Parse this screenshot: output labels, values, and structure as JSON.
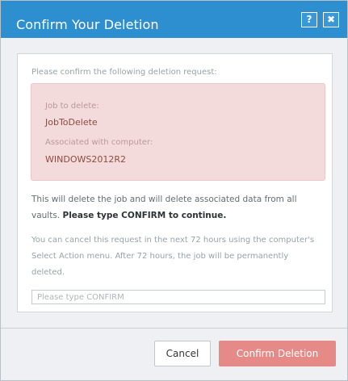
{
  "dialog": {
    "title": "Confirm Your Deletion",
    "help_label": "?",
    "close_label": "✖"
  },
  "content": {
    "intro": "Please confirm the following deletion request:",
    "job_label": "Job to delete:",
    "job_value": "JobToDelete",
    "computer_label": "Associated with computer:",
    "computer_value": "WINDOWS2012R2",
    "warning_text": "This will delete the job and will delete associated data from all vaults.",
    "warning_bold": "Please type CONFIRM to continue.",
    "cancel_info": "You can cancel this request in the next 72 hours using the computer's Select Action menu. After 72 hours, the job will be permanently deleted.",
    "input_placeholder": "Please type CONFIRM",
    "input_value": ""
  },
  "buttons": {
    "cancel": "Cancel",
    "confirm": "Confirm Deletion"
  },
  "colors": {
    "titlebar": "#2d8fd0",
    "details_bg": "#f4dbdb",
    "confirm_button": "#e58a86"
  }
}
